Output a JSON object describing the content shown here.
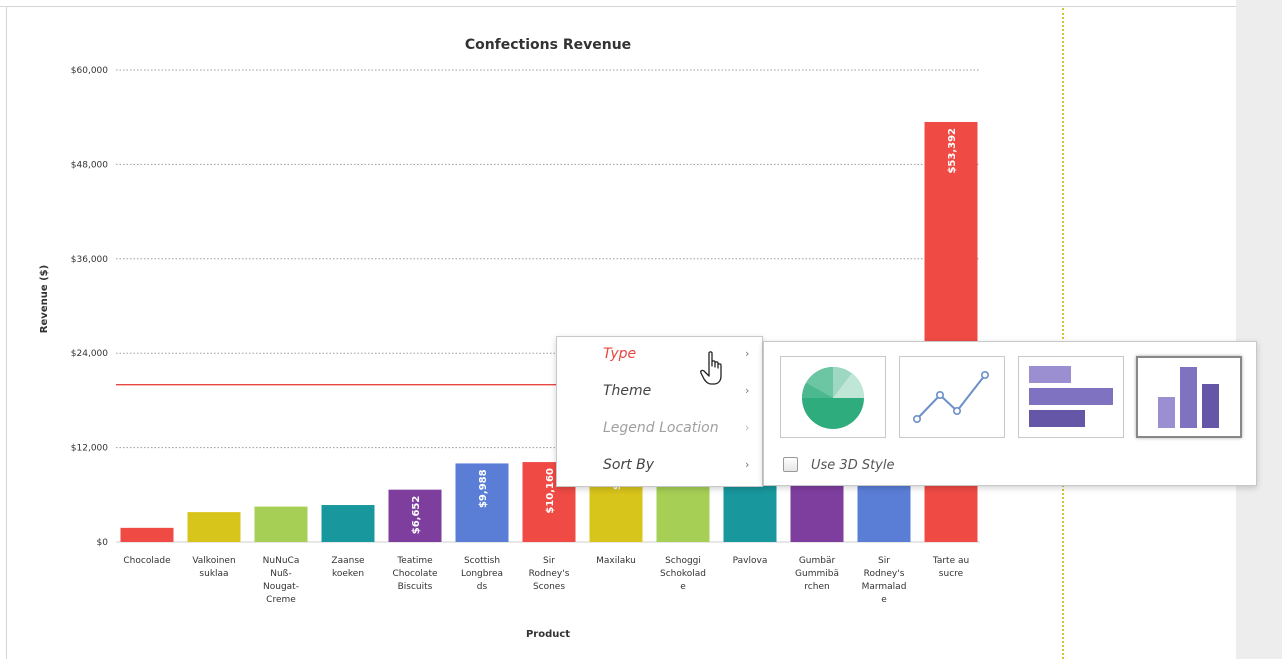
{
  "chart_data": {
    "type": "bar",
    "title": "Confections Revenue",
    "xlabel": "Product",
    "ylabel": "Revenue ($)",
    "ylim": [
      0,
      60000
    ],
    "yticks": [
      "$60,000",
      "$48,000",
      "$36,000",
      "$24,000",
      "$12,000",
      "$0"
    ],
    "ytick_values": [
      60000,
      48000,
      36000,
      24000,
      12000,
      0
    ],
    "grid": true,
    "reference_line": {
      "value": 20000,
      "color": "#e8463f"
    },
    "categories": [
      [
        "Chocolade"
      ],
      [
        "Valkoinen",
        "suklaa"
      ],
      [
        "NuNuCa",
        "Nuß-",
        "Nougat-",
        "Creme"
      ],
      [
        "Zaanse",
        "koeken"
      ],
      [
        "Teatime",
        "Chocolate",
        "Biscuits"
      ],
      [
        "Scottish",
        "Longbrea",
        "ds"
      ],
      [
        "Sir",
        "Rodney's",
        "Scones"
      ],
      [
        "Maxilaku"
      ],
      [
        "Schoggi",
        "Schokolad",
        "e"
      ],
      [
        "Pavlova"
      ],
      [
        "Gumbär",
        "Gummibä",
        "rchen"
      ],
      [
        "Sir",
        "Rodney's",
        "Marmalad",
        "e"
      ],
      [
        "Tarte au",
        "sucre"
      ]
    ],
    "values": [
      1800,
      3800,
      4500,
      4700,
      6652,
      9988,
      10160,
      10500,
      11000,
      15500,
      16000,
      21000,
      53392
    ],
    "data_labels": [
      "",
      "",
      "",
      "",
      "$6,652",
      "$9,988",
      "$10,160",
      "$10,",
      "",
      "",
      "",
      "",
      "$53,392"
    ],
    "colors": [
      "#f04a44",
      "#d8c51b",
      "#a6cf55",
      "#18979d",
      "#7e3e9e",
      "#5a7ed6",
      "#f04a44",
      "#d8c51b",
      "#a6cf55",
      "#18979d",
      "#7e3e9e",
      "#5a7ed6",
      "#f04a44"
    ]
  },
  "context_menu": {
    "items": [
      {
        "label": "Type",
        "state": "active"
      },
      {
        "label": "Theme",
        "state": "normal"
      },
      {
        "label": "Legend Location",
        "state": "disabled"
      },
      {
        "label": "Sort By",
        "state": "normal"
      }
    ],
    "submenu_arrow": "›"
  },
  "type_submenu": {
    "options": [
      {
        "icon": "pie-chart-icon",
        "selected": false
      },
      {
        "icon": "line-chart-icon",
        "selected": false
      },
      {
        "icon": "horizontal-bar-chart-icon",
        "selected": false
      },
      {
        "icon": "column-chart-icon",
        "selected": true
      }
    ],
    "use_3d_label": "Use 3D Style",
    "use_3d_checked": false
  },
  "cursor": {
    "icon": "hand-pointer-icon"
  }
}
